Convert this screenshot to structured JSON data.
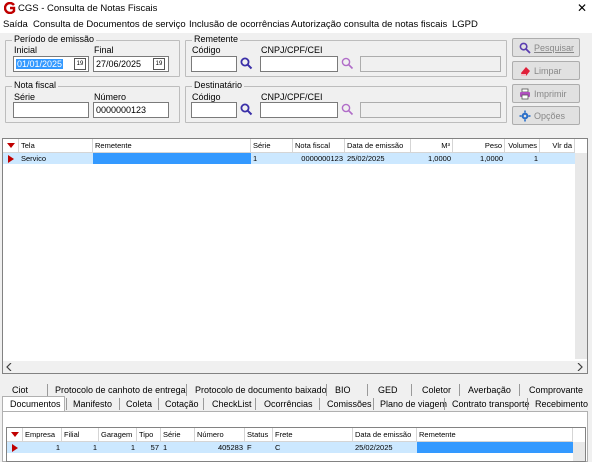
{
  "window": {
    "title": "CGS - Consulta de Notas Fiscais",
    "close_glyph": "✕"
  },
  "menu": [
    "Saída",
    "Consulta de Documentos de serviço",
    "Inclusão de ocorrências",
    "Autorização consulta de notas fiscais",
    "LGPD"
  ],
  "periodo": {
    "legend": "Período de emissão",
    "inicial_label": "Inicial",
    "inicial_value": "01/01/2025",
    "final_label": "Final",
    "final_value": "27/06/2025",
    "cal_glyph": "19"
  },
  "nota": {
    "legend": "Nota fiscal",
    "serie_label": "Série",
    "serie_value": "",
    "numero_label": "Número",
    "numero_value": "0000000123"
  },
  "remetente": {
    "legend": "Remetente",
    "codigo_label": "Código",
    "codigo_value": "",
    "cnpj_label": "CNPJ/CPF/CEI",
    "cnpj_value": "",
    "nome_value": ""
  },
  "destinatario": {
    "legend": "Destinatário",
    "codigo_label": "Código",
    "codigo_value": "",
    "cnpj_label": "CNPJ/CPF/CEI",
    "cnpj_value": "",
    "nome_value": ""
  },
  "buttons": {
    "pesquisar": "Pesquisar",
    "limpar": "Limpar",
    "imprimir": "Imprimir",
    "opcoes": "Opções"
  },
  "grid1": {
    "headers": [
      "Tela",
      "Remetente",
      "Série",
      "Nota fiscal",
      "Data de emissão",
      "M³",
      "Peso",
      "Volumes",
      "Vlr da"
    ],
    "row": {
      "tela": "Servico",
      "remetente": "",
      "serie": "1",
      "nota": "0000000123",
      "data": "25/02/2025",
      "m3": "1,0000",
      "peso": "1,0000",
      "volumes": "1"
    }
  },
  "tabs_row1": [
    "Ciot",
    "Protocolo de canhoto de entrega",
    "Protocolo de documento baixado",
    "BIO",
    "GED",
    "Coletor",
    "Averbação",
    "Comprovante"
  ],
  "tabs_row2": [
    "Documentos",
    "Manifesto",
    "Coleta",
    "Cotação",
    "CheckList",
    "Ocorrências",
    "Comissões",
    "Plano de viagem",
    "Contrato transporte",
    "Recebimento"
  ],
  "grid2": {
    "headers": [
      "Empresa",
      "Filial",
      "Garagem",
      "Tipo",
      "Série",
      "Número",
      "Status",
      "Frete",
      "Data de emissão",
      "Remetente"
    ],
    "row": {
      "empresa": "1",
      "filial": "1",
      "garagem": "1",
      "tipo": "57",
      "serie": "1",
      "numero": "405283",
      "status": "F",
      "frete": "C",
      "data": "25/02/2025",
      "remetente": ""
    }
  },
  "colors": {
    "selection": "#3399ff",
    "row_selected": "#cce8ff",
    "marker_red": "#c00000"
  }
}
